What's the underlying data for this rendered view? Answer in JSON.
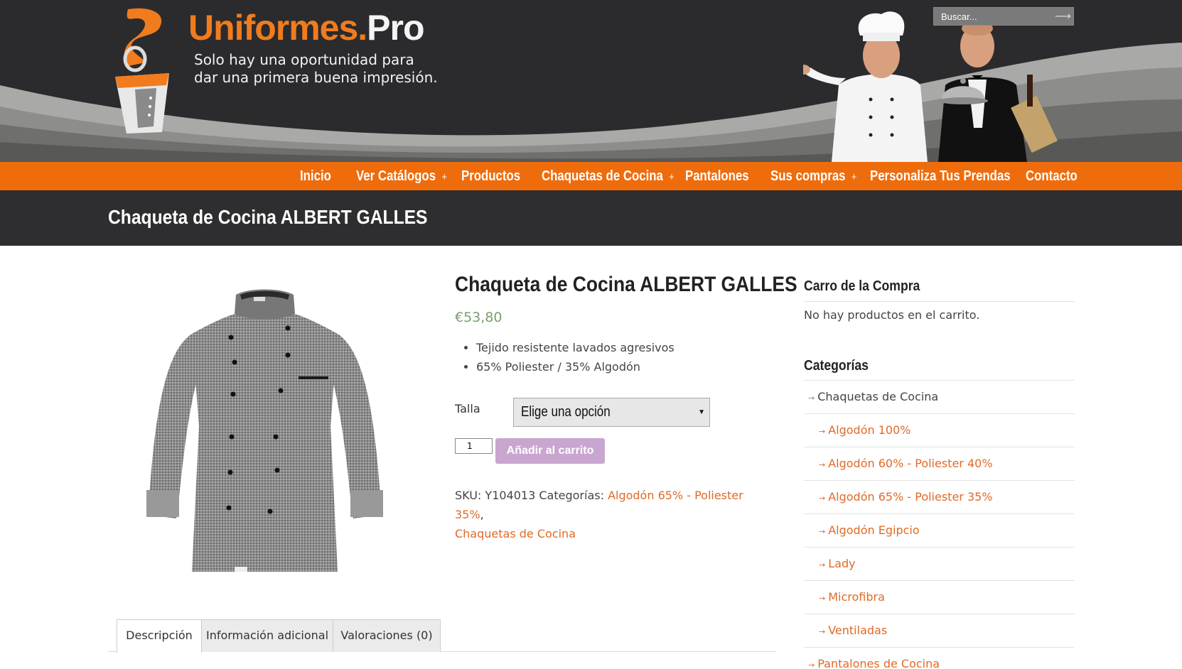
{
  "header": {
    "brand_part1": "Uniformes",
    "brand_dot": ".",
    "brand_part2": "Pro",
    "tagline_line1": "Solo hay una oportunidad para",
    "tagline_line2": "dar una primera buena impresión.",
    "search_placeholder": "Buscar...",
    "search_icon": "arrow-right-icon"
  },
  "nav": {
    "items": [
      {
        "label": "Inicio",
        "has_submenu": false
      },
      {
        "label": "Ver Catálogos",
        "has_submenu": true
      },
      {
        "label": "Productos",
        "has_submenu": false
      },
      {
        "label": "Chaquetas de Cocina",
        "has_submenu": true
      },
      {
        "label": "Pantalones",
        "has_submenu": false
      },
      {
        "label": "Sus compras",
        "has_submenu": true
      },
      {
        "label": "Personaliza Tus Prendas",
        "has_submenu": false
      },
      {
        "label": "Contacto",
        "has_submenu": false
      }
    ],
    "submenu_marker": "+"
  },
  "page_title": "Chaqueta de Cocina ALBERT GALLES",
  "product": {
    "title": "Chaqueta de Cocina ALBERT GALLES",
    "price": "€53,80",
    "features": [
      "Tejido resistente lavados agresivos",
      "65% Poliester / 35% Algodón"
    ],
    "talla_label": "Talla",
    "select_value": "Elige una opción",
    "quantity": "1",
    "add_to_cart_label": "Añadir al carrito",
    "sku_label": "SKU:",
    "sku_value": "Y104013",
    "categories_label": "Categorías:",
    "categories": [
      "Algodón 65% - Poliester 35%",
      "Chaquetas de Cocina"
    ],
    "category_separator": ","
  },
  "tabs": [
    "Descripción",
    "Información adicional",
    "Valoraciones (0)"
  ],
  "sidebar": {
    "cart_title": "Carro de la Compra",
    "cart_empty": "No hay productos en el carrito.",
    "categories_title": "Categorías",
    "categories": [
      {
        "label": "Chaquetas de Cocina",
        "level": "parent"
      },
      {
        "label": "Algodón 100%",
        "level": "child"
      },
      {
        "label": "Algodón 60% - Poliester 40%",
        "level": "child"
      },
      {
        "label": "Algodón 65% - Poliester 35%",
        "level": "child"
      },
      {
        "label": "Algodón Egipcio",
        "level": "child"
      },
      {
        "label": "Lady",
        "level": "child"
      },
      {
        "label": "Microfibra",
        "level": "child"
      },
      {
        "label": "Ventiladas",
        "level": "child"
      },
      {
        "label": "Pantalones de Cocina",
        "level": "child"
      }
    ],
    "arrow": "→"
  },
  "colors": {
    "header_bg": "#2b2b2d",
    "nav_bg": "#ef6c0c",
    "brand_orange": "#f07c1e",
    "link": "#e06a26",
    "price": "#7b9e6e",
    "add_to_cart_bg": "#c9a6d0"
  }
}
